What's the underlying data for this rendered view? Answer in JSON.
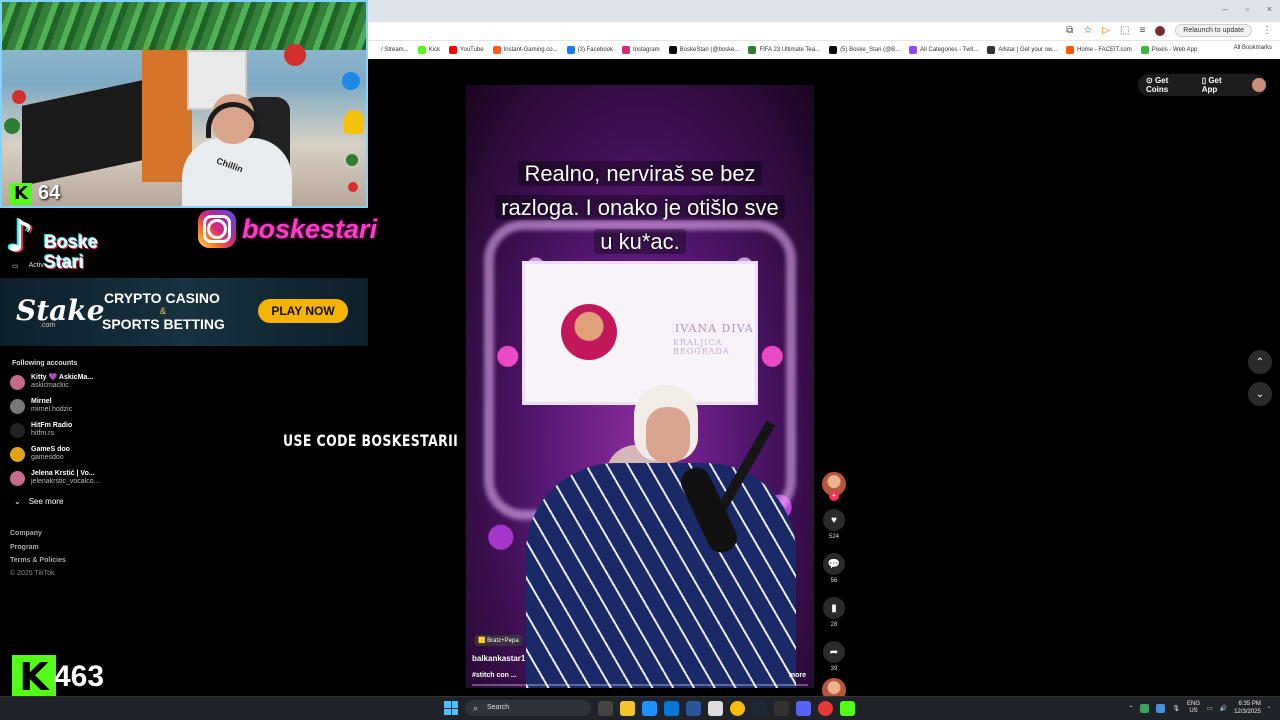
{
  "browser": {
    "relaunch_label": "Relaunch to update",
    "window_controls": [
      "–",
      "▫",
      "×"
    ],
    "bookmarks": [
      {
        "label": "/ Stream...",
        "color": "#ffffff"
      },
      {
        "label": "Kick",
        "color": "#53fc18"
      },
      {
        "label": "YouTube",
        "color": "#ff0000"
      },
      {
        "label": "Instant-Gaming.co...",
        "color": "#ff5a1f"
      },
      {
        "label": "(3) Facebook",
        "color": "#1877f2"
      },
      {
        "label": "Instagram",
        "color": "#d62976"
      },
      {
        "label": "BoskeStari (@boske...",
        "color": "#000000"
      },
      {
        "label": "FIFA 23 Ultimate Tea...",
        "color": "#2e7d32"
      },
      {
        "label": "(5) Boske_Stari (@B...",
        "color": "#000000"
      },
      {
        "label": "All Categories - Twit...",
        "color": "#9146ff"
      },
      {
        "label": "Allstar | Get your ow...",
        "color": "#333333"
      },
      {
        "label": "Home - FACEIT.com",
        "color": "#ff5500"
      },
      {
        "label": "Pixels - Web App",
        "color": "#3db83d"
      }
    ],
    "all_bookmarks": "All Bookmarks"
  },
  "tiktok": {
    "get_coins": "Get Coins",
    "get_app": "Get App",
    "following_title": "Following accounts",
    "following": [
      {
        "name": "Kitty 💜 AskicMa...",
        "user": "askicmackic",
        "color": "#c46a8a"
      },
      {
        "name": "Mirnel",
        "user": "mirnel.hodzic",
        "color": "#777777"
      },
      {
        "name": "HitFm Radio",
        "user": "hitfm.rs",
        "color": "#222222"
      },
      {
        "name": "GameS doo",
        "user": "gamesdoo",
        "color": "#e3a21a"
      },
      {
        "name": "Jelena Krstić | Vo...",
        "user": "jelenakrstic_vocalco...",
        "color": "#c76b8f"
      }
    ],
    "see_more": "See more",
    "footer": [
      "Company",
      "Program",
      "Terms & Policies"
    ],
    "copyright": "© 2025 TikTok",
    "video": {
      "caption_lines": [
        "Realno, nerviraš se bez",
        "razloga. I onako je otišlo sve",
        "u ku*ac."
      ],
      "screen_title": "IVANA DIVA",
      "screen_subtitle": "KRALJICA BEOGRADA",
      "sticker": "🟨 Bratz+Pepa",
      "username": "balkankastar1",
      "description": "#stitch con ...",
      "more": "more",
      "progress": 0.0
    },
    "actions": {
      "likes": "524",
      "comments": "56",
      "saves": "28",
      "shares": "39"
    }
  },
  "overlay": {
    "kick_count_small": "64",
    "tiktok_name_line1": "Boske",
    "tiktok_name_line2": "Stari",
    "active_label": "Activ",
    "instagram_name": "boskestari",
    "shirt_text": "Chillin",
    "stake": {
      "logo": "Stake",
      "domain": ".com",
      "line1": "CRYPTO CASINO",
      "amp": "&",
      "line2": "SPORTS BETTING",
      "cta": "PLAY NOW"
    },
    "promo_code": "USE CODE BOSKESTARII",
    "kick_count_big": "463",
    "kick_username": "boskestari",
    "kick_letter": "K"
  },
  "taskbar": {
    "search_placeholder": "Search",
    "lang_top": "ENG",
    "lang_bottom": "US",
    "time": "6:35 PM",
    "date": "12/3/2025"
  }
}
